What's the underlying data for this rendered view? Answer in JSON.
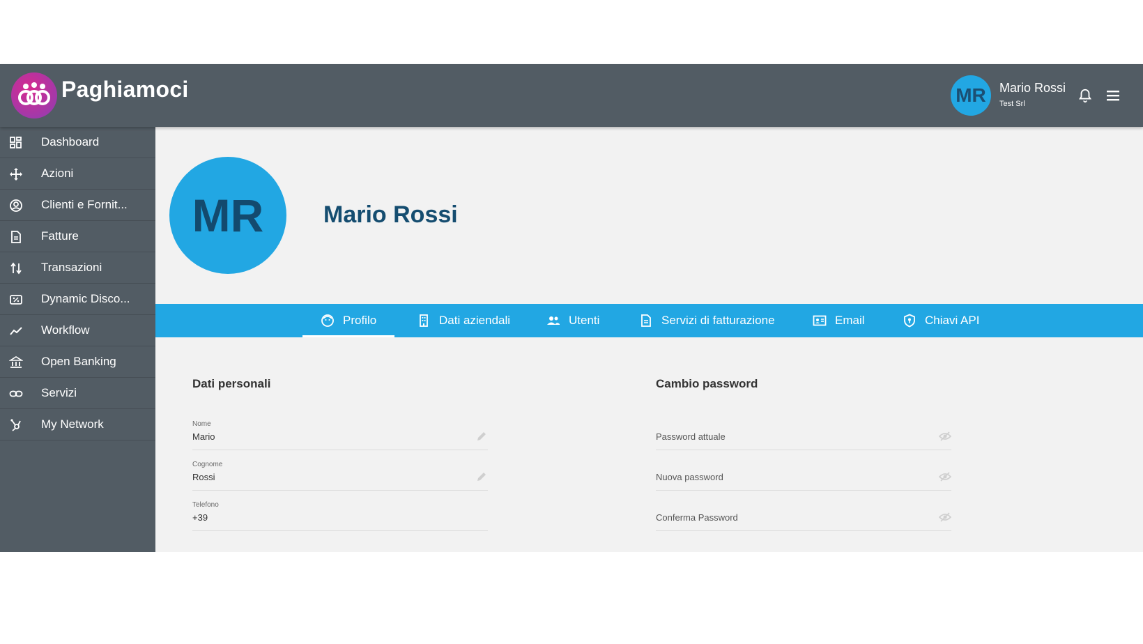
{
  "header": {
    "brand": "Paghiamoci",
    "user": {
      "initials": "MR",
      "name": "Mario Rossi",
      "company": "Test Srl"
    },
    "icons": {
      "logo": "paghiamoci-logo",
      "bell": "bell-icon",
      "menu": "hamburger-menu-icon"
    }
  },
  "sidebar": {
    "items": [
      {
        "label": "Dashboard",
        "icon": "dashboard-grid-icon"
      },
      {
        "label": "Azioni",
        "icon": "move-arrows-icon"
      },
      {
        "label": "Clienti e Fornit...",
        "icon": "user-circle-icon"
      },
      {
        "label": "Fatture",
        "icon": "document-icon"
      },
      {
        "label": "Transazioni",
        "icon": "transfer-arrows-icon"
      },
      {
        "label": "Dynamic Disco...",
        "icon": "discount-tag-icon"
      },
      {
        "label": "Workflow",
        "icon": "trend-line-icon"
      },
      {
        "label": "Open Banking",
        "icon": "bank-icon"
      },
      {
        "label": "Servizi",
        "icon": "link-icon"
      },
      {
        "label": "My Network",
        "icon": "network-icon"
      }
    ]
  },
  "profile": {
    "initials": "MR",
    "name": "Mario Rossi"
  },
  "tabs": [
    {
      "label": "Profilo",
      "icon": "face-icon",
      "active": true
    },
    {
      "label": "Dati aziendali",
      "icon": "building-icon",
      "active": false
    },
    {
      "label": "Utenti",
      "icon": "users-icon",
      "active": false
    },
    {
      "label": "Servizi di fatturazione",
      "icon": "invoice-icon",
      "active": false
    },
    {
      "label": "Email",
      "icon": "email-card-icon",
      "active": false
    },
    {
      "label": "Chiavi API",
      "icon": "shield-key-icon",
      "active": false
    }
  ],
  "personal": {
    "title": "Dati personali",
    "fields": [
      {
        "label": "Nome",
        "value": "Mario",
        "icon": "pencil-icon"
      },
      {
        "label": "Cognome",
        "value": "Rossi",
        "icon": "pencil-icon"
      },
      {
        "label": "Telefono",
        "value": "+39"
      }
    ]
  },
  "password": {
    "title": "Cambio password",
    "fields": [
      {
        "placeholder": "Password attuale",
        "icon": "eye-off-icon"
      },
      {
        "placeholder": "Nuova password",
        "icon": "eye-off-icon"
      },
      {
        "placeholder": "Conferma Password",
        "icon": "eye-off-icon"
      }
    ]
  },
  "colors": {
    "header_bg": "#525c64",
    "accent": "#22a7e3",
    "name_text": "#154d70",
    "content_bg": "#f2f2f2"
  }
}
